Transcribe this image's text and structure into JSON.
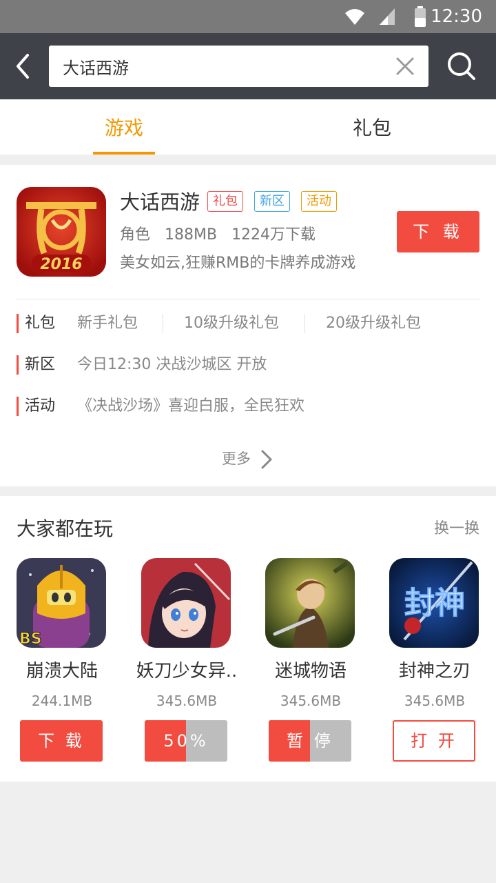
{
  "status_bar": {
    "time": "12:30"
  },
  "search": {
    "query": "大话西游"
  },
  "tabs": [
    {
      "label": "游戏",
      "active": true
    },
    {
      "label": "礼包",
      "active": false
    }
  ],
  "featured": {
    "name": "大话西游",
    "tags": [
      "礼包",
      "新区",
      "活动"
    ],
    "category": "角色",
    "size": "188MB",
    "downloads": "1224万下载",
    "description": "美女如云,狂赚RMB的卡牌养成游戏",
    "download_label": "下 载",
    "icon_text": "2016",
    "rows": {
      "gift": {
        "label": "礼包",
        "items": [
          "新手礼包",
          "10级升级礼包",
          "20级升级礼包"
        ]
      },
      "server": {
        "label": "新区",
        "text": "今日12:30 决战沙城区 开放"
      },
      "event": {
        "label": "活动",
        "text": "《决战沙场》喜迎白服，全民狂欢"
      }
    },
    "more_label": "更多"
  },
  "recommendations": {
    "title": "大家都在玩",
    "refresh_label": "换一换",
    "items": [
      {
        "name": "崩溃大陆",
        "size": "244.1MB",
        "button": "下 载",
        "state": "download",
        "icon_badge": "BS"
      },
      {
        "name": "妖刀少女异..",
        "size": "345.6MB",
        "button": "50%",
        "state": "progress",
        "progress": 0.5
      },
      {
        "name": "迷城物语",
        "size": "345.6MB",
        "button": "暂 停",
        "state": "paused",
        "progress": 0.5
      },
      {
        "name": "封神之刃",
        "size": "345.6MB",
        "button": "打 开",
        "state": "open",
        "icon_text": "封神"
      }
    ]
  },
  "colors": {
    "accent_orange": "#f39800",
    "action_red": "#f24b3f",
    "header_dark": "#3f4248",
    "status_gray": "#7a7a7a"
  }
}
